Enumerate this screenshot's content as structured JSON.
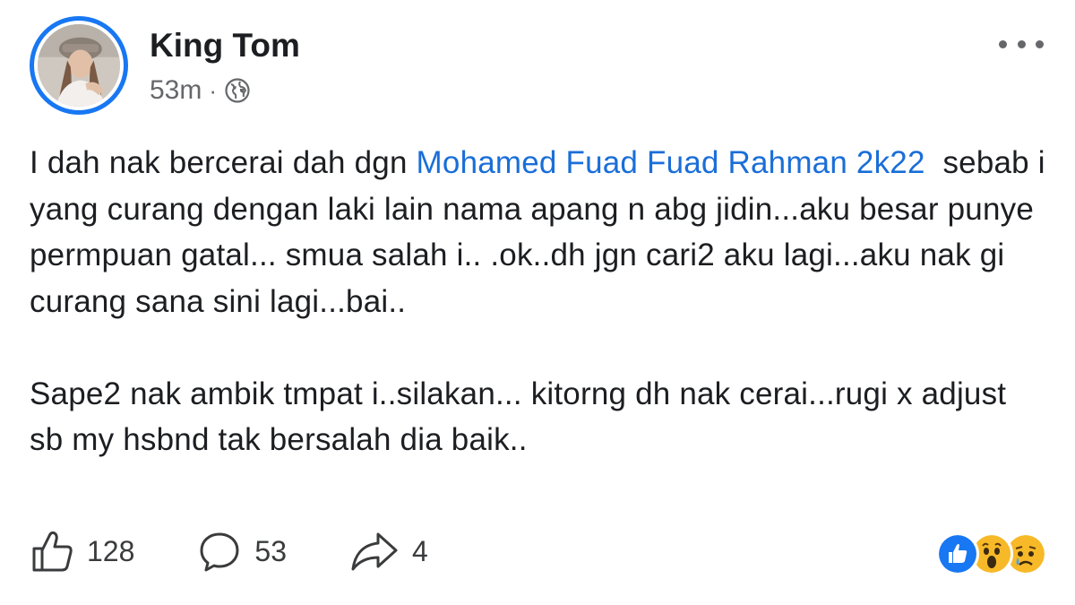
{
  "author": {
    "name": "King Tom",
    "time": "53m",
    "separator": "·",
    "visibility_icon": "globe-icon",
    "avatar_ring_color": "#1877f2"
  },
  "menu": {
    "icon": "more-horizontal-icon"
  },
  "post": {
    "text_before_mention": "I dah nak bercerai dah dgn ",
    "mention": "Mohamed Fuad Fuad Rahman 2k22",
    "text_after_mention": "  sebab i yang curang dengan laki lain nama apang n abg jidin...aku besar punye permpuan gatal... smua salah i.. .ok..dh jgn cari2 aku lagi...aku nak gi curang sana sini lagi...bai..",
    "paragraph_2": "Sape2 nak ambik tmpat i..silakan... kitorng dh nak cerai...rugi x adjust sb my hsbnd tak bersalah dia baik..",
    "mention_color": "#1a6ed8"
  },
  "actions": {
    "like": {
      "icon": "thumbs-up-icon",
      "count": "128"
    },
    "comment": {
      "icon": "comment-icon",
      "count": "53"
    },
    "share": {
      "icon": "share-icon",
      "count": "4"
    }
  },
  "reactions": [
    "like-reaction-icon",
    "wow-reaction-icon",
    "sad-reaction-icon"
  ]
}
